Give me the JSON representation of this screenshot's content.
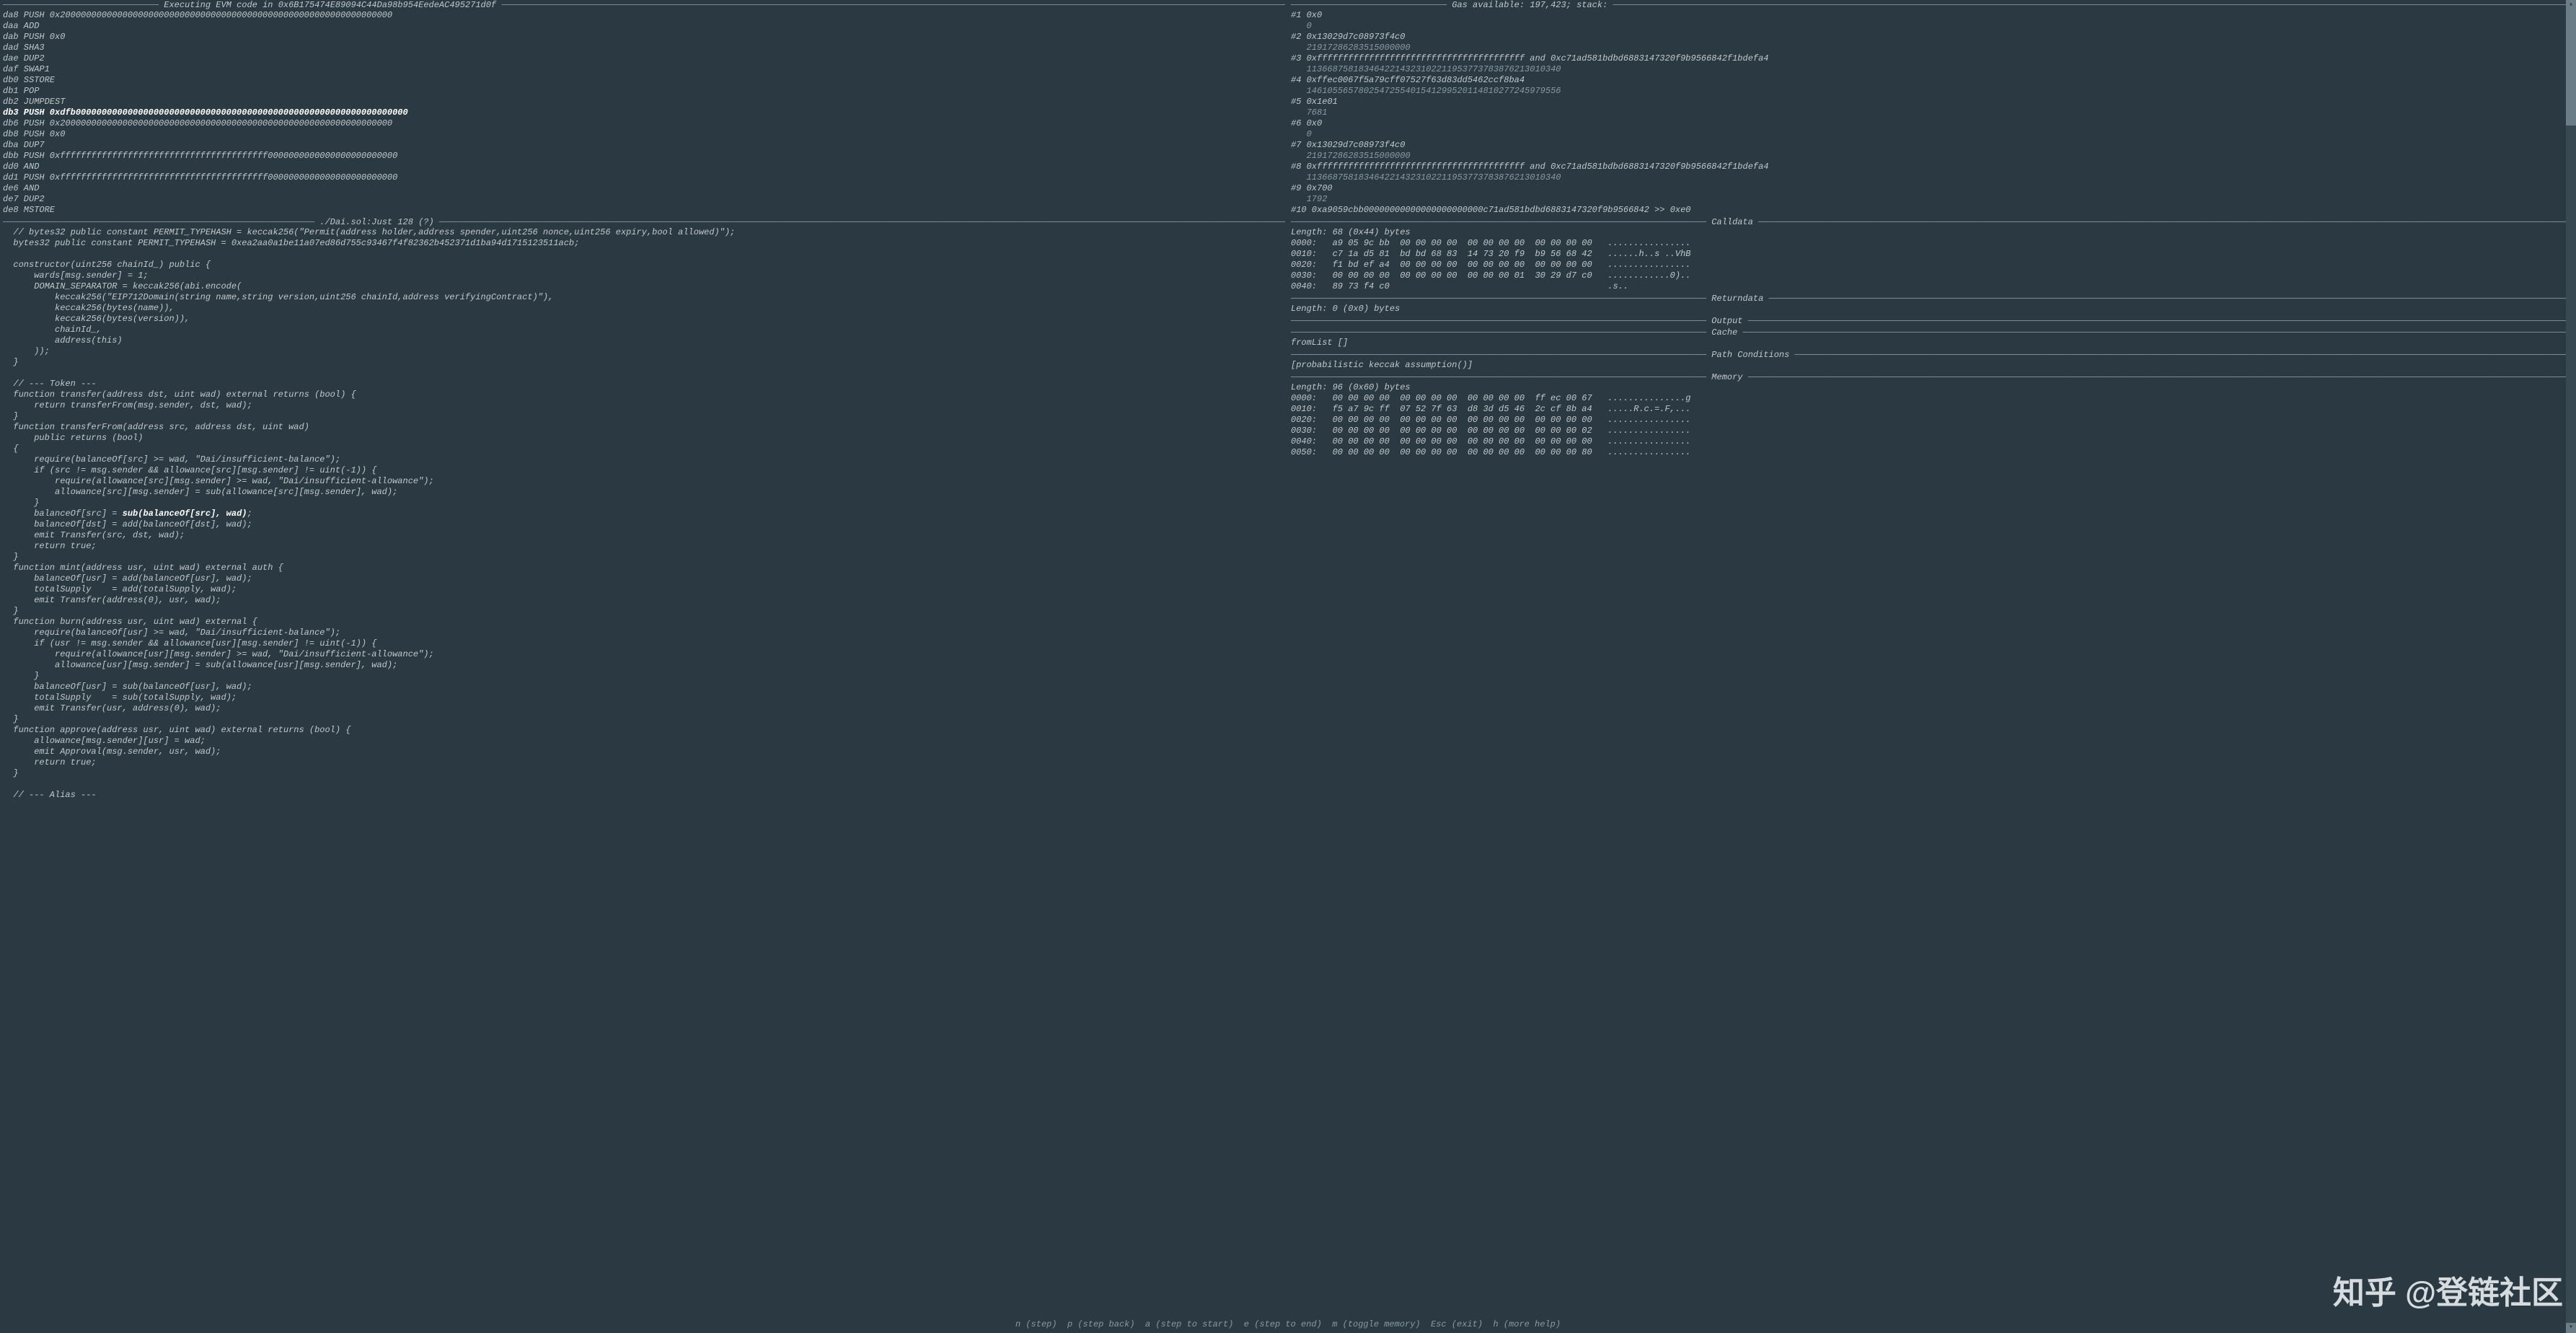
{
  "left": {
    "evm": {
      "title_prefix": "Executing EVM code in ",
      "address": "0x6B175474E89094C44Da98b954EedeAC495271d0f",
      "lines": [
        "da8 PUSH 0x2000000000000000000000000000000000000000000000000000000000000000",
        "daa ADD",
        "dab PUSH 0x0",
        "dad SHA3",
        "dae DUP2",
        "daf SWAP1",
        "db0 SSTORE",
        "db1 POP",
        "db2 JUMPDEST",
        "db3 PUSH 0xdfb0000000000000000000000000000000000000000000000000000000000000000",
        "db6 PUSH 0x2000000000000000000000000000000000000000000000000000000000000000",
        "db8 PUSH 0x0",
        "dba DUP7",
        "dbb PUSH 0xffffffffffffffffffffffffffffffffffffffff0000000000000000000000000",
        "dd0 AND",
        "dd1 PUSH 0xffffffffffffffffffffffffffffffffffffffff0000000000000000000000000",
        "de6 AND",
        "de7 DUP2",
        "de8 MSTORE"
      ],
      "current_index": 9
    },
    "source": {
      "title_prefix": "./Dai.sol:Just 128 (?)",
      "lines": [
        "  // bytes32 public constant PERMIT_TYPEHASH = keccak256(\"Permit(address holder,address spender,uint256 nonce,uint256 expiry,bool allowed)\");",
        "  bytes32 public constant PERMIT_TYPEHASH = 0xea2aa0a1be11a07ed86d755c93467f4f82362b452371d1ba94d1715123511acb;",
        "",
        "  constructor(uint256 chainId_) public {",
        "      wards[msg.sender] = 1;",
        "      DOMAIN_SEPARATOR = keccak256(abi.encode(",
        "          keccak256(\"EIP712Domain(string name,string version,uint256 chainId,address verifyingContract)\"),",
        "          keccak256(bytes(name)),",
        "          keccak256(bytes(version)),",
        "          chainId_,",
        "          address(this)",
        "      ));",
        "  }",
        "",
        "  // --- Token ---",
        "  function transfer(address dst, uint wad) external returns (bool) {",
        "      return transferFrom(msg.sender, dst, wad);",
        "  }",
        "  function transferFrom(address src, address dst, uint wad)",
        "      public returns (bool)",
        "  {",
        "      require(balanceOf[src] >= wad, \"Dai/insufficient-balance\");",
        "      if (src != msg.sender && allowance[src][msg.sender] != uint(-1)) {",
        "          require(allowance[src][msg.sender] >= wad, \"Dai/insufficient-allowance\");",
        "          allowance[src][msg.sender] = sub(allowance[src][msg.sender], wad);",
        "      }",
        "      balanceOf[src] = sub(balanceOf[src], wad);",
        "      balanceOf[dst] = add(balanceOf[dst], wad);",
        "      emit Transfer(src, dst, wad);",
        "      return true;",
        "  }",
        "  function mint(address usr, uint wad) external auth {",
        "      balanceOf[usr] = add(balanceOf[usr], wad);",
        "      totalSupply    = add(totalSupply, wad);",
        "      emit Transfer(address(0), usr, wad);",
        "  }",
        "  function burn(address usr, uint wad) external {",
        "      require(balanceOf[usr] >= wad, \"Dai/insufficient-balance\");",
        "      if (usr != msg.sender && allowance[usr][msg.sender] != uint(-1)) {",
        "          require(allowance[usr][msg.sender] >= wad, \"Dai/insufficient-allowance\");",
        "          allowance[usr][msg.sender] = sub(allowance[usr][msg.sender], wad);",
        "      }",
        "      balanceOf[usr] = sub(balanceOf[usr], wad);",
        "      totalSupply    = sub(totalSupply, wad);",
        "      emit Transfer(usr, address(0), wad);",
        "  }",
        "  function approve(address usr, uint wad) external returns (bool) {",
        "      allowance[msg.sender][usr] = wad;",
        "      emit Approval(msg.sender, usr, wad);",
        "      return true;",
        "  }",
        "",
        "  // --- Alias ---"
      ],
      "highlight_line": 26,
      "highlight_frag": "sub(balanceOf[src], wad)"
    }
  },
  "right": {
    "gas": {
      "title": "Gas available: 197,423; stack:"
    },
    "stack": {
      "entries": [
        {
          "idx": "#1",
          "head": "0x0",
          "sub": "0"
        },
        {
          "idx": "#2",
          "head": "0x13029d7c08973f4c0",
          "sub": "21917286283515000000"
        },
        {
          "idx": "#3",
          "head": "0xffffffffffffffffffffffffffffffffffffffff and 0xc71ad581bdbd6883147320f9b9566842f1bdefa4",
          "sub": "1136687581834642214323102211953773783876213010340"
        },
        {
          "idx": "#4",
          "head": "0xffec0067f5a79cff07527f63d83dd5462ccf8ba4",
          "sub": "1461055657802547255401541299520114810277245979556"
        },
        {
          "idx": "#5",
          "head": "0x1e01",
          "sub": "7681"
        },
        {
          "idx": "#6",
          "head": "0x0",
          "sub": "0"
        },
        {
          "idx": "#7",
          "head": "0x13029d7c08973f4c0",
          "sub": "21917286283515000000"
        },
        {
          "idx": "#8",
          "head": "0xffffffffffffffffffffffffffffffffffffffff and 0xc71ad581bdbd6883147320f9b9566842f1bdefa4",
          "sub": "1136687581834642214323102211953773783876213010340"
        },
        {
          "idx": "#9",
          "head": "0x700",
          "sub": "1792"
        },
        {
          "idx": "#10",
          "head": "0xa9059cbb00000000000000000000000c71ad581bdbd6883147320f9b9566842 >> 0xe0",
          "sub": ""
        }
      ]
    },
    "calldata": {
      "title": "Calldata",
      "length": "Length: 68 (0x44) bytes",
      "rows": [
        "0000:   a9 05 9c bb  00 00 00 00  00 00 00 00  00 00 00 00   ................",
        "0010:   c7 1a d5 81  bd bd 68 83  14 73 20 f9  b9 56 68 42   ......h..s ..VhB",
        "0020:   f1 bd ef a4  00 00 00 00  00 00 00 00  00 00 00 00   ................",
        "0030:   00 00 00 00  00 00 00 00  00 00 00 01  30 29 d7 c0   ............0)..",
        "0040:   89 73 f4 c0                                          .s.."
      ]
    },
    "returndata": {
      "title": "Returndata",
      "length": "Length: 0 (0x0) bytes"
    },
    "output": {
      "title": "Output"
    },
    "cache": {
      "title": "Cache",
      "body": "fromList []"
    },
    "pathconds": {
      "title": "Path Conditions",
      "body": "[probabilistic keccak assumption()]"
    },
    "memory": {
      "title": "Memory",
      "length": "Length: 96 (0x60) bytes",
      "rows": [
        "0000:   00 00 00 00  00 00 00 00  00 00 00 00  ff ec 00 67   ...............g",
        "0010:   f5 a7 9c ff  07 52 7f 63  d8 3d d5 46  2c cf 8b a4   .....R.c.=.F,...",
        "0020:   00 00 00 00  00 00 00 00  00 00 00 00  00 00 00 00   ................",
        "0030:   00 00 00 00  00 00 00 00  00 00 00 00  00 00 00 02   ................",
        "0040:   00 00 00 00  00 00 00 00  00 00 00 00  00 00 00 00   ................",
        "0050:   00 00 00 00  00 00 00 00  00 00 00 00  00 00 00 80   ................"
      ]
    }
  },
  "footer": {
    "hints": "n (step)  p (step back)  a (step to start)  e (step to end)  m (toggle memory)  Esc (exit)  h (more help)"
  },
  "watermark": "知乎 @登链社区"
}
